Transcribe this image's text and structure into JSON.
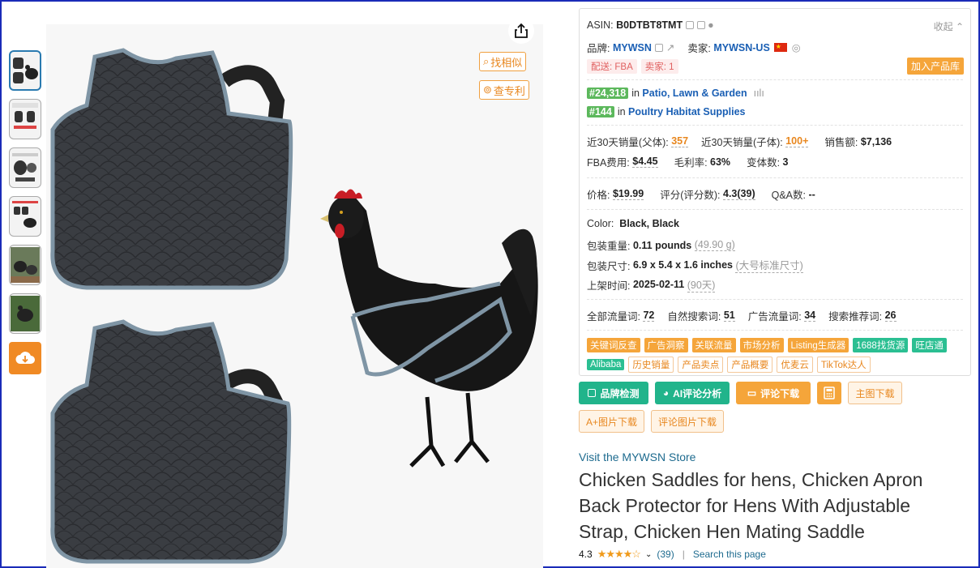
{
  "thumbnails": [
    "thumb-1",
    "thumb-2",
    "thumb-3",
    "thumb-4",
    "thumb-5",
    "thumb-6"
  ],
  "image_tools": {
    "find_similar": "找相似",
    "patent_check": "查专利"
  },
  "panel": {
    "asin_label": "ASIN:",
    "asin": "B0DTBT8TMT",
    "collapse": "收起",
    "brand_label": "品牌:",
    "brand": "MYWSN",
    "seller_label": "卖家:",
    "seller": "MYWSN-US",
    "ship_label": "配送: FBA",
    "sellers_count": "卖家: 1",
    "add_library": "加入产品库",
    "rank1": "#24,318",
    "rank1_in": "in",
    "rank1_cat": "Patio, Lawn & Garden",
    "rank2": "#144",
    "rank2_in": "in",
    "rank2_cat": "Poultry Habitat Supplies",
    "sales30_parent_label": "近30天销量(父体):",
    "sales30_parent": "357",
    "sales30_child_label": "近30天销量(子体):",
    "sales30_child": "100+",
    "revenue_label": "销售额:",
    "revenue": "$7,136",
    "fba_label": "FBA费用:",
    "fba": "$4.45",
    "margin_label": "毛利率:",
    "margin": "63%",
    "variants_label": "变体数:",
    "variants": "3",
    "price_label": "价格:",
    "price": "$19.99",
    "rating_label": "评分(评分数):",
    "rating": "4.3(39)",
    "qa_label": "Q&A数:",
    "qa": "--",
    "color_label": "Color:",
    "color": "Black, Black",
    "weight_label": "包装重量:",
    "weight": "0.11 pounds",
    "weight_g": "(49.90 g)",
    "size_label": "包装尺寸:",
    "size": "6.9 x 5.4 x 1.6 inches",
    "size_tier": "(大号标准尺寸)",
    "listed_label": "上架时间:",
    "listed": "2025-02-11",
    "listed_days": "(90天)",
    "kw_all_label": "全部流量词:",
    "kw_all": "72",
    "kw_organic_label": "自然搜索词:",
    "kw_organic": "51",
    "kw_ad_label": "广告流量词:",
    "kw_ad": "34",
    "kw_rec_label": "搜索推荐词:",
    "kw_rec": "26",
    "tags_row1": [
      {
        "label": "关键词反查",
        "style": "o"
      },
      {
        "label": "广告洞察",
        "style": "o"
      },
      {
        "label": "关联流量",
        "style": "o"
      },
      {
        "label": "市场分析",
        "style": "o"
      },
      {
        "label": "Listing生成器",
        "style": "o"
      },
      {
        "label": "1688找货源",
        "style": "g"
      },
      {
        "label": "旺店通",
        "style": "g"
      }
    ],
    "tags_row2": [
      {
        "label": "Alibaba",
        "style": "g"
      },
      {
        "label": "历史销量",
        "style": "p"
      },
      {
        "label": "产品卖点",
        "style": "p"
      },
      {
        "label": "产品概要",
        "style": "p"
      },
      {
        "label": "优麦云",
        "style": "p"
      },
      {
        "label": "TikTok达人",
        "style": "p"
      }
    ]
  },
  "actions": {
    "brand_check": "品牌检测",
    "ai_review": "AI评论分析",
    "review_download": "评论下载",
    "main_img_download": "主图下载",
    "aplus_download": "A+图片下载",
    "review_img_download": "评论图片下载"
  },
  "product": {
    "store_link": "Visit the MYWSN Store",
    "title": "Chicken Saddles for hens, Chicken Apron Back Protector for Hens With Adjustable Strap, Chicken Hen Mating Saddle",
    "rating": "4.3",
    "stars": "★★★★☆",
    "review_count": "(39)",
    "search_page": "Search this page"
  },
  "colors": {
    "accent_orange": "#f5a53a",
    "accent_green": "#21b48b",
    "rank_green": "#5cb85c",
    "link_blue": "#1e6b8f"
  }
}
